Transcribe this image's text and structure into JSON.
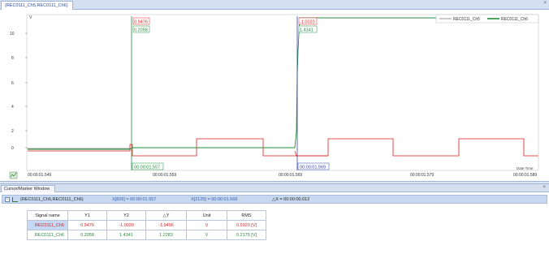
{
  "window": {
    "tab_title": "(REC0111_Ch5,REC0111_Ch6)",
    "close_glyph": "×"
  },
  "plot": {
    "y_ticks": [
      "10",
      "8",
      "6",
      "4",
      "2",
      "0"
    ],
    "y_top_label": "V",
    "x_ticks": [
      "00:00:01.549",
      "00:00:01.559",
      "00:00:01.569",
      "00:00:01.579",
      "00:00:01.589"
    ],
    "x_axis_caption": "Date Time",
    "cursor1": {
      "y1": "0.9476",
      "y2": "0.2058",
      "time": "00:00:01.557"
    },
    "cursor2": {
      "y1": "-1.0020",
      "y2": "1.4341",
      "time": "00:00:01.569"
    },
    "legend": [
      "REC0111_Ch5",
      "REC0111_Ch6"
    ],
    "colors": {
      "ch5": "#e31b1b",
      "ch6": "#1e8f3a",
      "grey": "#7a7a7a",
      "cursor1": "#1e8f3a",
      "cursor2": "#3344aa"
    }
  },
  "cursor_window": {
    "title": "Cursor/Marker Window",
    "close_glyph": "×",
    "group": {
      "collapse_glyph": "−",
      "name": "(REC0111_Ch5,REC0111_Ch6)",
      "x1": "X[826] = 00:00:01.557",
      "x2": "X[2125] = 00:00:01.569",
      "dx": "△X = 00:00:00.012"
    },
    "table": {
      "headers": [
        "Signal name",
        "Y1",
        "Y2",
        "△Y",
        "Unit",
        "RMS"
      ],
      "rows": [
        {
          "name": "REC0111_Ch5",
          "y1": "0.9476",
          "y2": "-1.0020",
          "dy": "-1.9496",
          "unit": "V",
          "rms": "0.5920 [V]"
        },
        {
          "name": "REC0111_Ch6",
          "y1": "0.2058",
          "y2": "1.4341",
          "dy": "1.2283",
          "unit": "V",
          "rms": "0.2175 [V]"
        }
      ]
    }
  }
}
